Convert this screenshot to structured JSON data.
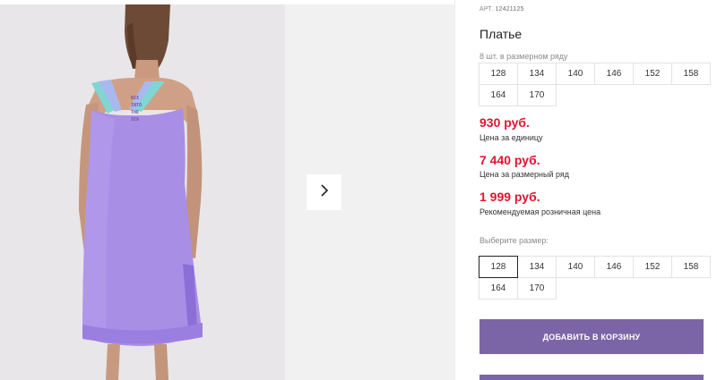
{
  "product": {
    "article_label": "АРТ.",
    "article_value": "12421125",
    "title": "Платье",
    "range_note": "8 шт. в размерном ряду"
  },
  "size_range": [
    "128",
    "134",
    "140",
    "146",
    "152",
    "158",
    "164",
    "170"
  ],
  "prices": [
    {
      "value": "930 руб.",
      "note": "Цена за единицу"
    },
    {
      "value": "7 440 руб.",
      "note": "Цена за размерный ряд"
    },
    {
      "value": "1 999 руб.",
      "note": "Рекомендуемая розничная цена"
    }
  ],
  "size_select": {
    "label": "Выберите размер:",
    "selected": "128",
    "options": [
      "128",
      "134",
      "140",
      "146",
      "152",
      "158",
      "164",
      "170"
    ]
  },
  "actions": {
    "add_to_cart": "ДОБАВИТЬ В КОРЗИНУ"
  },
  "icons": {
    "next": "chevron-right-icon"
  },
  "colors": {
    "accent": "#7c65a6",
    "price": "#e0152f",
    "dress": "#a98ee6",
    "straps": "#7fd6d2"
  }
}
